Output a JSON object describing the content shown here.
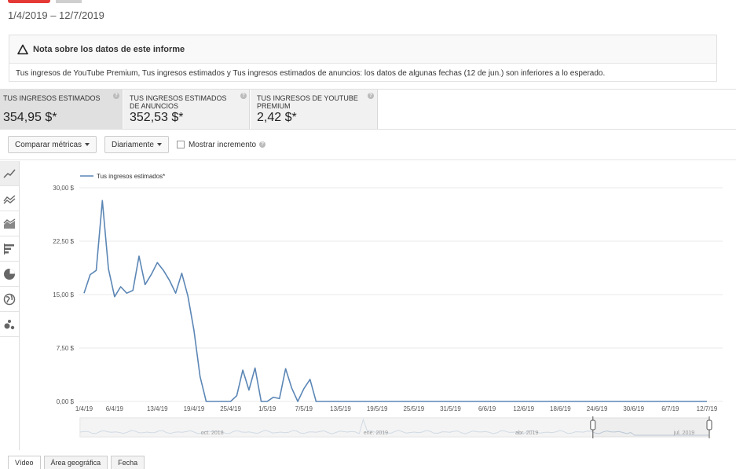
{
  "header": {
    "date_range": "1/4/2019 – 12/7/2019"
  },
  "note": {
    "title": "Nota sobre los datos de este informe",
    "body": "Tus ingresos de YouTube Premium, Tus ingresos estimados y Tus ingresos estimados de anuncios: los datos de algunas fechas (12 de jun.) son inferiores a lo esperado."
  },
  "metrics": [
    {
      "label": "Tus ingresos estimados",
      "value": "354,95 $*"
    },
    {
      "label": "Tus ingresos estimados de anuncios",
      "value": "352,53 $*"
    },
    {
      "label": "Tus ingresos de YouTube Premium",
      "value": "2,42 $*"
    }
  ],
  "toolbar": {
    "compare_label": "Comparar métricas",
    "interval_label": "Diariamente",
    "show_increment_label": "Mostrar incremento"
  },
  "side_tools": [
    "line-chart-icon",
    "multi-line-icon",
    "area-chart-icon",
    "bar-chart-icon",
    "pie-chart-icon",
    "globe-icon",
    "bubble-chart-icon"
  ],
  "colors": {
    "series": "#5b86b5",
    "grid": "#e8e8e8"
  },
  "chart_data": {
    "type": "line",
    "legend": "Tus ingresos estimados*",
    "legend_position": "top-left",
    "grid": true,
    "ylim": [
      0,
      30
    ],
    "y_ticks": [
      "0,00 $",
      "7,50 $",
      "15,00 $",
      "22,50 $",
      "30,00 $"
    ],
    "x_ticks": [
      "1/4/19",
      "6/4/19",
      "13/4/19",
      "19/4/19",
      "25/4/19",
      "1/5/19",
      "7/5/19",
      "13/5/19",
      "19/5/19",
      "25/5/19",
      "31/5/19",
      "6/6/19",
      "12/6/19",
      "18/6/19",
      "24/6/19",
      "30/6/19",
      "6/7/19",
      "12/7/19"
    ],
    "x_tick_days": [
      0,
      5,
      12,
      18,
      24,
      30,
      36,
      42,
      48,
      54,
      60,
      66,
      72,
      78,
      84,
      90,
      96,
      102
    ],
    "series": [
      {
        "name": "Tus ingresos estimados*",
        "values": [
          15.2,
          17.8,
          18.4,
          28.2,
          18.6,
          14.7,
          16.1,
          15.2,
          15.6,
          20.4,
          16.4,
          17.8,
          19.5,
          18.4,
          17.0,
          15.2,
          18.0,
          14.8,
          10.0,
          3.5,
          0.0,
          0.0,
          0.0,
          0.0,
          0.0,
          0.8,
          4.4,
          1.6,
          4.7,
          0.0,
          0.0,
          0.6,
          0.4,
          4.6,
          1.9,
          0.0,
          1.8,
          3.1,
          0.0,
          0.0,
          0.0,
          0.0,
          0.0,
          0.0,
          0.0,
          0.0,
          0.0,
          0.0,
          0.0,
          0.0,
          0.0,
          0.0,
          0.0,
          0.0,
          0.0,
          0.0,
          0.0,
          0.0,
          0.0,
          0.0,
          0.0,
          0.0,
          0.0,
          0.0,
          0.0,
          0.0,
          0.0,
          0.0,
          0.0,
          0.0,
          0.0,
          0.0,
          0.0,
          0.0,
          0.0,
          0.0,
          0.0,
          0.0,
          0.0,
          0.0,
          0.0,
          0.0,
          0.0,
          0.0,
          0.0,
          0.0,
          0.0,
          0.0,
          0.0,
          0.0,
          0.0,
          0.0,
          0.0,
          0.0,
          0.0,
          0.0,
          0.0,
          0.0,
          0.0,
          0.0,
          0.0,
          0.0,
          0.0
        ]
      }
    ]
  },
  "overview": {
    "labels": [
      "oct. 2018",
      "ene. 2019",
      "abr. 2019",
      "jul. 2019"
    ],
    "selection": [
      0.815,
      1.0
    ]
  },
  "tabs": [
    "Vídeo",
    "Área geográfica",
    "Fecha"
  ]
}
